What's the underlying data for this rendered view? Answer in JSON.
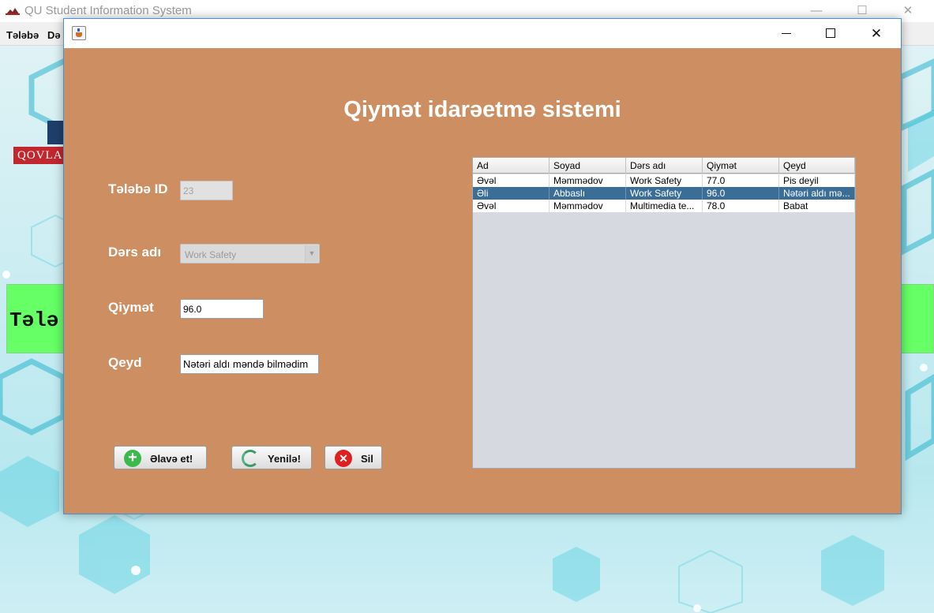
{
  "main_window": {
    "title": "QU Student Information System",
    "menu": [
      "Tələbə",
      "Də"
    ],
    "logo_text": "QOVLA",
    "banner_text": "Tələ"
  },
  "dialog": {
    "title": "Qiymət idarəetmə sistemi",
    "labels": {
      "telebe_id": "Tələbə ID",
      "ders_adi": "Dərs adı",
      "qiymet": "Qiymət",
      "qeyd": "Qeyd"
    },
    "fields": {
      "telebe_id": "23",
      "ders_adi": "Work Safety",
      "qiymet": "96.0",
      "qeyd": "Nətəri aldı məndə bilmədim"
    },
    "buttons": {
      "add": "Əlavə et!",
      "refresh": "Yenilə!",
      "delete": "Sil"
    },
    "table": {
      "columns": [
        "Ad",
        "Soyad",
        "Dərs adı",
        "Qiymət",
        "Qeyd"
      ],
      "rows": [
        [
          "Əvəl",
          "Məmmədov",
          "Work Safety",
          "77.0",
          "Pis deyil"
        ],
        [
          "Əli",
          "Abbaslı",
          "Work Safety",
          "96.0",
          "Nətəri aldı mə..."
        ],
        [
          "Əvəl",
          "Məmmədov",
          "Multimedia te...",
          "78.0",
          "Babat"
        ]
      ],
      "selected_row": 1
    }
  },
  "colors": {
    "dialog_bg": "#cd8e62",
    "selection": "#3b6e97",
    "accent_green": "#66ff66"
  },
  "icons": [
    "java-cup-icon",
    "add-icon",
    "refresh-icon",
    "delete-icon"
  ]
}
